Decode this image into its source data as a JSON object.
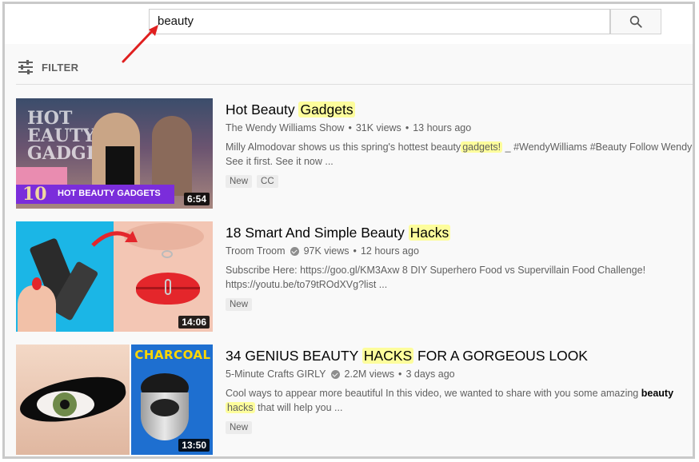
{
  "search": {
    "query": "beauty"
  },
  "filter": {
    "label": "FILTER"
  },
  "results": [
    {
      "title_plain": "Hot Beauty ",
      "title_hl": "Gadgets",
      "title_rest": "",
      "channel": "The Wendy Williams Show",
      "verified": false,
      "views": "31K views",
      "age": "13 hours ago",
      "desc_a": "Milly Almodovar shows us this spring's hottest beauty",
      "desc_hl": "gadgets!",
      "desc_b": "_ #WendyWilliams #Beauty Follow Wendy See it first. See it now ...",
      "badges": [
        "New",
        "CC"
      ],
      "duration": "6:54",
      "thumb_caption": "HOT BEAUTY GADGETS",
      "thumb_logo": "10",
      "thumb_overlay": "HOT EAUTY GADGETS"
    },
    {
      "title_plain": "18 Smart And Simple Beauty ",
      "title_hl": "Hacks",
      "title_rest": "",
      "channel": "Troom Troom",
      "verified": true,
      "views": "97K views",
      "age": "12 hours ago",
      "desc_line1": "Subscribe Here: https://goo.gl/KM3Axw 8 DIY Superhero Food vs Supervillain Food Challenge!",
      "desc_line2": "https://youtu.be/to79tROdXVg?list ...",
      "badges": [
        "New"
      ],
      "duration": "14:06"
    },
    {
      "title_plain": "34 GENIUS BEAUTY ",
      "title_hl": "HACKS",
      "title_rest": " FOR A GORGEOUS LOOK",
      "channel": "5-Minute Crafts GIRLY",
      "verified": true,
      "views": "2.2M views",
      "age": "3 days ago",
      "desc_a": "Cool ways to appear more beautiful In this video, we wanted to share with you some amazing",
      "desc_bold": "beauty",
      "desc_hl": "hacks",
      "desc_b": "that will help you ...",
      "badges": [
        "New"
      ],
      "duration": "13:50",
      "thumb_caption": "CHARCOAL"
    }
  ],
  "colors": {
    "highlight": "#fdfd9c",
    "annotation_arrow": "#e02020"
  }
}
